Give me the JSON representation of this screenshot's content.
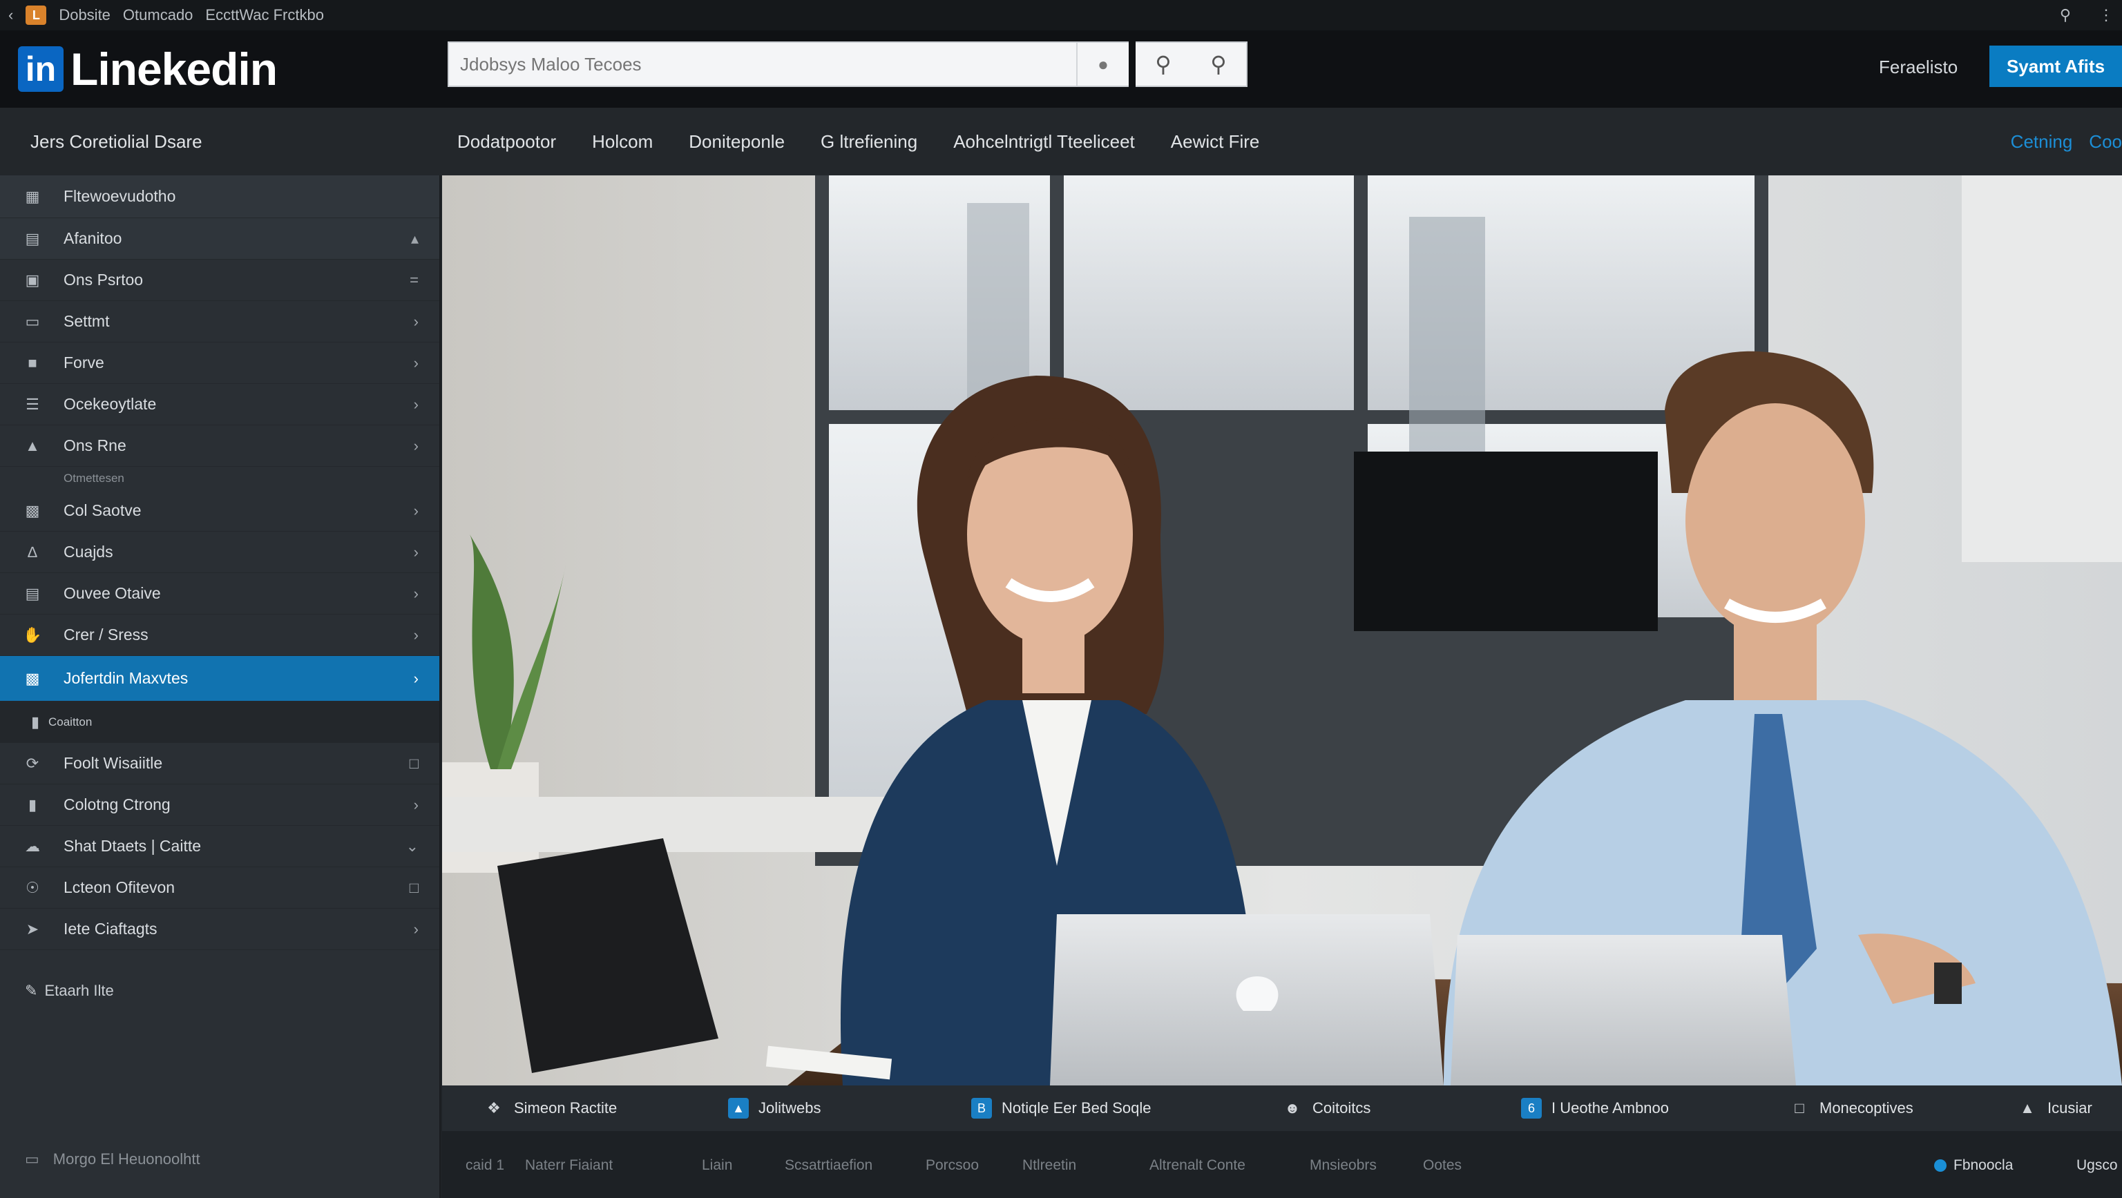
{
  "os_bar": {
    "title_left": "Dobsite",
    "title_mid": "Otumcado",
    "title_right": "EccttWac Frctkbo",
    "icons": [
      "app-logo-icon",
      "search-icon",
      "dots-icon"
    ]
  },
  "header": {
    "brand": "Linekedin",
    "brand_box": "in",
    "search_placeholder": "Jdobsys Maloo Tecoes",
    "link": "Feraelisto",
    "cta": "Syamt Afits",
    "accent": "#0a66c2"
  },
  "nav": {
    "section_title": "Jers Coretiolial Dsare",
    "items": [
      "Dodatpootor",
      "Holcom",
      "Doniteponle",
      "G ltrefiening",
      "Aohcelntrigtl Tteeliceet",
      "Aewict Fire"
    ],
    "right": [
      "Cetning",
      "Coo"
    ]
  },
  "sidebar": {
    "top": "Fltewoevudotho",
    "head": "Afanitoo",
    "items": [
      {
        "label": "Ons Psrtoo",
        "icon": "window-icon",
        "chev": "="
      },
      {
        "label": "Settmt",
        "icon": "monitor-icon",
        "chev": "›"
      },
      {
        "label": "Forve",
        "icon": "briefcase-icon",
        "chev": "›"
      },
      {
        "label": "Ocekeoytlate",
        "icon": "list-icon",
        "chev": "›"
      },
      {
        "label": "Ons Rne",
        "icon": "chart-icon",
        "chev": "›"
      }
    ],
    "sub1": "Otmettesen",
    "items2": [
      {
        "label": "Col Saotve",
        "icon": "doc-icon",
        "chev": "›"
      },
      {
        "label": "Cuajds",
        "icon": "trophy-icon",
        "chev": "›"
      },
      {
        "label": "Ouvee Otaive",
        "icon": "stack-icon",
        "chev": "›"
      },
      {
        "label": "Crer / Sress",
        "icon": "hand-icon",
        "chev": "›"
      }
    ],
    "active": {
      "label": "Jofertdin Maxvtes",
      "icon": "grid-icon",
      "chev": "›"
    },
    "sub2": "Coaitton",
    "items3": [
      {
        "label": "Foolt Wisaiitle",
        "icon": "refresh-icon",
        "chev": "□"
      },
      {
        "label": "Colotng Ctrong",
        "icon": "bar-icon",
        "chev": "›"
      },
      {
        "label": "Shat Dtaets | Caitte",
        "icon": "cloud-icon",
        "chev": "⌄"
      },
      {
        "label": "Lcteon Ofitevon",
        "icon": "pin-icon",
        "chev": "□"
      },
      {
        "label": "Iete Ciaftagts",
        "icon": "plane-icon",
        "chev": "›"
      }
    ],
    "plain": "Etaarh Ilte",
    "footer": "Morgo El Heuonoolhtt"
  },
  "bar1": [
    {
      "label": "Simeon Ractite",
      "icon": "tag-icon"
    },
    {
      "label": "Jolitwebs",
      "icon": "image-icon"
    },
    {
      "label": "Notiqle Eer Bed Soqle",
      "icon": "b-icon"
    },
    {
      "label": "Coitoitcs",
      "icon": "user-icon"
    },
    {
      "label": "I Ueothe Ambnoo",
      "icon": "phone-icon"
    },
    {
      "label": "Monecoptives",
      "icon": "square-icon"
    },
    {
      "label": "Icusiar",
      "icon": "mountain-icon"
    }
  ],
  "bar2": {
    "items": [
      "caid 1",
      "Naterr Fiaiant",
      "Liain",
      "Scsatrtiaefion",
      "Porcsoo",
      "Ntlreetin",
      "Altrenalt Conte",
      "Mnsieobrs",
      "Ootes"
    ],
    "right": [
      "Fbnoocla",
      "Ugsco"
    ]
  }
}
